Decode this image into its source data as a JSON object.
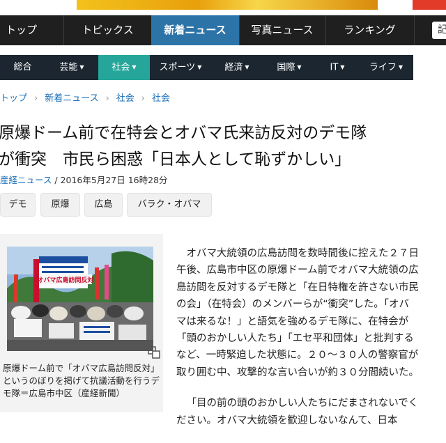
{
  "main_nav": {
    "items": [
      "トップ",
      "トピックス",
      "新着ニュース",
      "写真ニュース",
      "ランキング"
    ],
    "active": 2,
    "search_label": "記"
  },
  "sub_nav": {
    "items": [
      "総合",
      "芸能",
      "社会",
      "スポーツ",
      "経済",
      "国際",
      "IT",
      "ライフ"
    ],
    "active": 2
  },
  "breadcrumb": [
    "トップ",
    "新着ニュース",
    "社会",
    "社会"
  ],
  "article": {
    "title_line1": "原爆ドーム前で在特会とオバマ氏来訪反対のデモ隊",
    "title_line2": "が衝突　市民ら困惑「日本人として恥ずかしい」",
    "source": "産経ニュース",
    "date_sep": " / ",
    "date": "2016年5月27日 16時28分",
    "tags": [
      "デモ",
      "原爆",
      "広島",
      "バラク・オバマ"
    ],
    "caption": "原爆ドーム前で「オバマ広島訪問反対」というのぼりを掲げて抗議活動を行うデモ隊＝広島市中区（産経新聞）",
    "photo_banner_text": "オバマ広島訪問反対",
    "paragraphs": [
      "オバマ大統領の広島訪問を数時間後に控えた２７日午後、広島市中区の原爆ドーム前でオバマ大統領の広島訪問を反対するデモ隊と「在日特権を許さない市民の会」（在特会）のメンバーらが“衝突”した。「オバマは来るな！」と語気を強めるデモ隊に、在特会が「頭のおかしい人たち」「エセ平和団体」と批判するなど、一時緊迫した状態に。２０～３０人の警察官が取り囲む中、攻撃的な言い合いが約３０分間続いた。",
      "「目の前の頭のおかしい人たちにだまされないでください。オバマ大統領を歓迎しないなんて、日本"
    ]
  },
  "colors": {
    "main_nav_bg": "#1f1f1f",
    "main_nav_active": "#2c73a8",
    "sub_nav_bg": "#1b2630",
    "sub_nav_active": "#26a69a",
    "link": "#1a6fb8"
  }
}
